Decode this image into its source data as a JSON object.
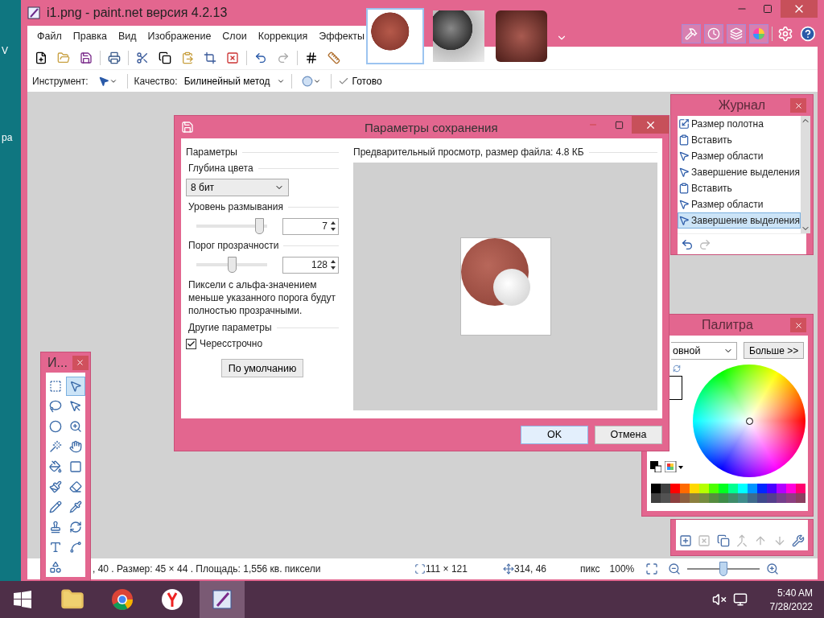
{
  "desktop": {
    "icon_labels": [
      "V",
      "pa"
    ]
  },
  "window": {
    "title": "i1.png - paint.net версия 4.2.13",
    "menu": [
      "Файл",
      "Правка",
      "Вид",
      "Изображение",
      "Слои",
      "Коррекция",
      "Эффекты"
    ],
    "image_tabs": [
      {
        "kind": "sphere",
        "selected": true
      },
      {
        "kind": "dark-sphere",
        "selected": false
      },
      {
        "kind": "texture",
        "selected": false
      }
    ]
  },
  "toolbar": {
    "tool_label": "Инструмент:",
    "quality_label": "Качество:",
    "quality_value": "Билинейный метод",
    "finish": "Готово"
  },
  "dialog": {
    "title": "Параметры сохранения",
    "section": "Параметры",
    "depth_label": "Глубина цвета",
    "depth_value": "8 бит",
    "blur_label": "Уровень размывания",
    "blur": {
      "level": 0.85,
      "value": "7"
    },
    "threshold_label": "Порог прозрачности",
    "threshold": {
      "level": 0.5,
      "value": "128"
    },
    "note": "Пиксели с альфа-значением меньше указанного порога будут полностью прозрачными.",
    "other_label": "Другие параметры",
    "interlaced": {
      "label": "Чересстрочно",
      "checked": true
    },
    "default_button": "По умолчанию",
    "preview_label": "Предварительный просмотр, размер файла: 4.8 КБ",
    "buttons": [
      {
        "label": "OK",
        "focused": true
      },
      {
        "label": "Отмена",
        "focused": false
      }
    ]
  },
  "history": {
    "title": "Журнал",
    "items": [
      {
        "label": "Размер полотна",
        "kind": "canvas",
        "selected": false
      },
      {
        "label": "Вставить",
        "kind": "paste",
        "selected": false
      },
      {
        "label": "Размер области",
        "kind": "select",
        "selected": false
      },
      {
        "label": "Завершение выделения",
        "kind": "select",
        "selected": false
      },
      {
        "label": "Вставить",
        "kind": "paste",
        "selected": false
      },
      {
        "label": "Размер области",
        "kind": "select",
        "selected": false
      },
      {
        "label": "Завершение выделения",
        "kind": "select",
        "selected": true
      }
    ]
  },
  "palette": {
    "title": "Палитра",
    "mode_value": "овной",
    "more_button": "Больше >>"
  },
  "tools": {
    "title": "И...",
    "items": [
      {
        "kind": "rect-select",
        "selected": false
      },
      {
        "kind": "move-selection",
        "selected": true
      },
      {
        "kind": "lasso",
        "selected": false
      },
      {
        "kind": "move-selected",
        "selected": false
      },
      {
        "kind": "ellipse-select",
        "selected": false
      },
      {
        "kind": "zoom",
        "selected": false
      },
      {
        "kind": "wand",
        "selected": false
      },
      {
        "kind": "pan",
        "selected": false
      },
      {
        "kind": "bucket",
        "selected": false
      },
      {
        "kind": "gradient",
        "selected": false
      },
      {
        "kind": "brush",
        "selected": false
      },
      {
        "kind": "eraser",
        "selected": false
      },
      {
        "kind": "pencil",
        "selected": false
      },
      {
        "kind": "picker",
        "selected": false
      },
      {
        "kind": "stamp",
        "selected": false
      },
      {
        "kind": "recolor",
        "selected": false
      },
      {
        "kind": "text",
        "selected": false
      },
      {
        "kind": "line",
        "selected": false
      },
      {
        "kind": "shapes",
        "selected": false
      }
    ]
  },
  "status": {
    "selection": ", 40 . Размер: 45  × 44 . Площадь: 1,556 кв. пиксели",
    "image_size": "111 × 121",
    "cursor": "314, 46",
    "units": "пикс",
    "zoom": "100%",
    "zoom_slider": {
      "level": 0.5
    }
  },
  "taskbar": {
    "apps": [
      {
        "kind": "explorer",
        "selected": false
      },
      {
        "kind": "chrome",
        "selected": false
      },
      {
        "kind": "yandex",
        "selected": false
      },
      {
        "kind": "paintnet",
        "selected": true
      }
    ],
    "time": "5:40 AM",
    "date": "7/28/2022"
  }
}
